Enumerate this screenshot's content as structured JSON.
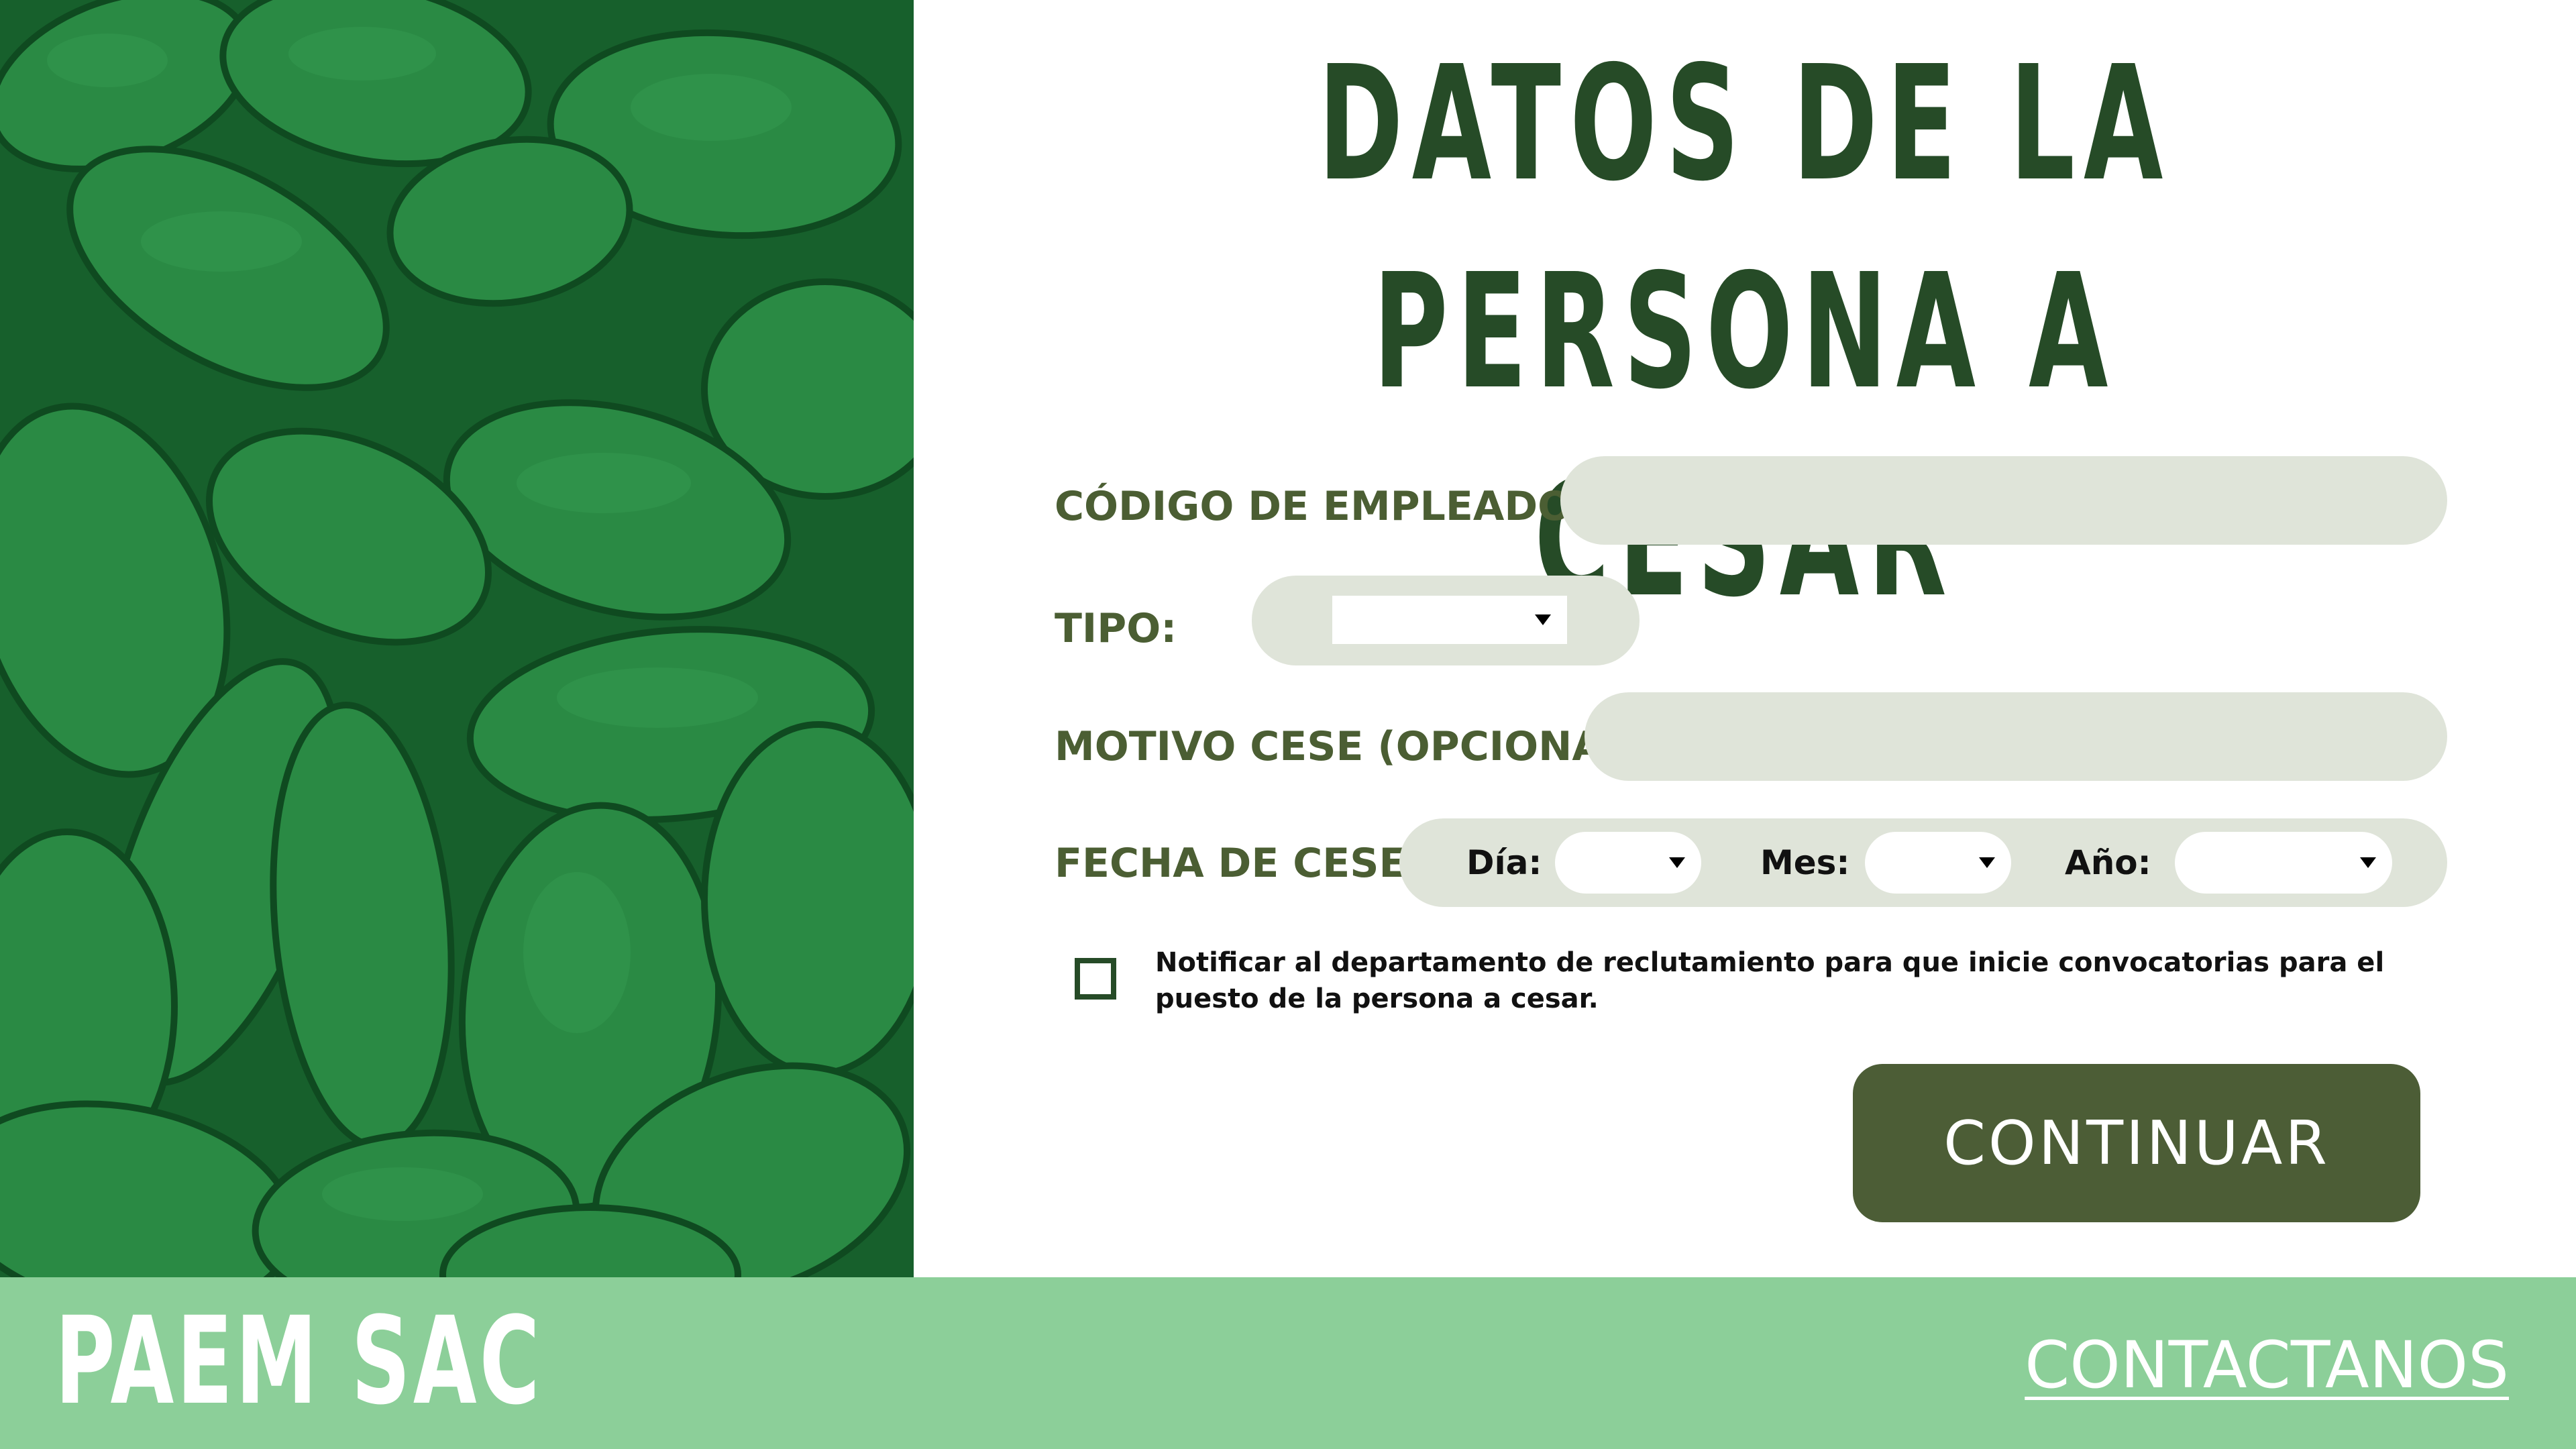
{
  "title": {
    "line1": "DATOS DE LA PERSONA A",
    "line2": "CESAR"
  },
  "form": {
    "codigo_label": "CÓDIGO DE EMPLEADO:",
    "codigo_value": "",
    "tipo_label": "TIPO:",
    "tipo_value": "",
    "motivo_label": "MOTIVO CESE (OPCIONAL):",
    "motivo_value": "",
    "fecha_label": "FECHA DE CESE:",
    "dia_label": "Día:",
    "dia_value": "",
    "mes_label": "Mes:",
    "mes_value": "",
    "anio_label": "Año:",
    "anio_value": "",
    "notify_checked": false,
    "notify_text": "Notificar al departamento de reclutamiento para que inicie convocatorias para el puesto de la persona a cesar.",
    "continue_label": "CONTINUAR"
  },
  "footer": {
    "brand": "PAEM SAC",
    "contact_label": "CONTACTANOS"
  },
  "colors": {
    "title": "#264b27",
    "label": "#4b5e33",
    "input_bg": "#dfe4d9",
    "button_bg": "#4c5d36",
    "footer_bg": "#8ccf99",
    "photo_bg": "#1f7a3b"
  }
}
